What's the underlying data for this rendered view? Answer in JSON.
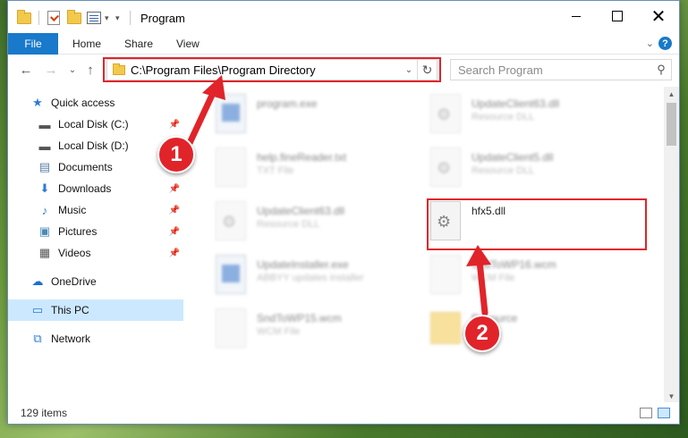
{
  "window": {
    "title": "Program",
    "close_glyph": "✕"
  },
  "ribbon": {
    "tabs": [
      "File",
      "Home",
      "Share",
      "View"
    ],
    "help": "?"
  },
  "navbar": {
    "address": "C:\\Program Files\\Program Directory",
    "search_placeholder": "Search Program"
  },
  "sidebar": {
    "items": [
      {
        "label": "Quick access",
        "icon": "star-icon",
        "pinned": false
      },
      {
        "label": "Local Disk (C:)",
        "icon": "drive-icon",
        "pinned": true
      },
      {
        "label": "Local Disk (D:)",
        "icon": "drive-icon",
        "pinned": false
      },
      {
        "label": "Documents",
        "icon": "documents-icon",
        "pinned": false
      },
      {
        "label": "Downloads",
        "icon": "downloads-icon",
        "pinned": true
      },
      {
        "label": "Music",
        "icon": "music-icon",
        "pinned": true
      },
      {
        "label": "Pictures",
        "icon": "pictures-icon",
        "pinned": true
      },
      {
        "label": "Videos",
        "icon": "videos-icon",
        "pinned": true
      },
      {
        "label": "OneDrive",
        "icon": "cloud-icon",
        "pinned": false
      },
      {
        "label": "This PC",
        "icon": "computer-icon",
        "pinned": false,
        "selected": true
      },
      {
        "label": "Network",
        "icon": "network-icon",
        "pinned": false
      }
    ]
  },
  "files": [
    {
      "name": "program.exe",
      "sub": "",
      "icon": "exe-icon",
      "blurred": true
    },
    {
      "name": "UpdateClient63.dll",
      "sub": "Resource DLL",
      "icon": "dll-icon",
      "blurred": true
    },
    {
      "name": "help.fineReader.txt",
      "sub": "TXT File",
      "icon": "txt-icon",
      "blurred": true
    },
    {
      "name": "UpdateClient5.dll",
      "sub": "Resource DLL",
      "icon": "dll-icon",
      "blurred": true
    },
    {
      "name": "UpdateClient63.dll",
      "sub": "Resource DLL",
      "icon": "dll-icon",
      "blurred": true
    },
    {
      "name": "hfx5.dll",
      "sub": "",
      "icon": "dll-icon",
      "blurred": false
    },
    {
      "name": "UpdateInstaller.exe",
      "sub": "ABBYY updates installer",
      "icon": "exe-icon",
      "blurred": true
    },
    {
      "name": "SndToWP16.wcm",
      "sub": "WCM File",
      "icon": "wcm-icon",
      "blurred": true
    },
    {
      "name": "SndToWP15.wcm",
      "sub": "WCM File",
      "icon": "wcm-icon",
      "blurred": true
    },
    {
      "name": "Resource",
      "sub": "",
      "icon": "folder-icon",
      "blurred": true
    }
  ],
  "status": {
    "item_count": "129 items"
  },
  "annotations": {
    "step1": "1",
    "step2": "2",
    "color": "#e0242a"
  }
}
